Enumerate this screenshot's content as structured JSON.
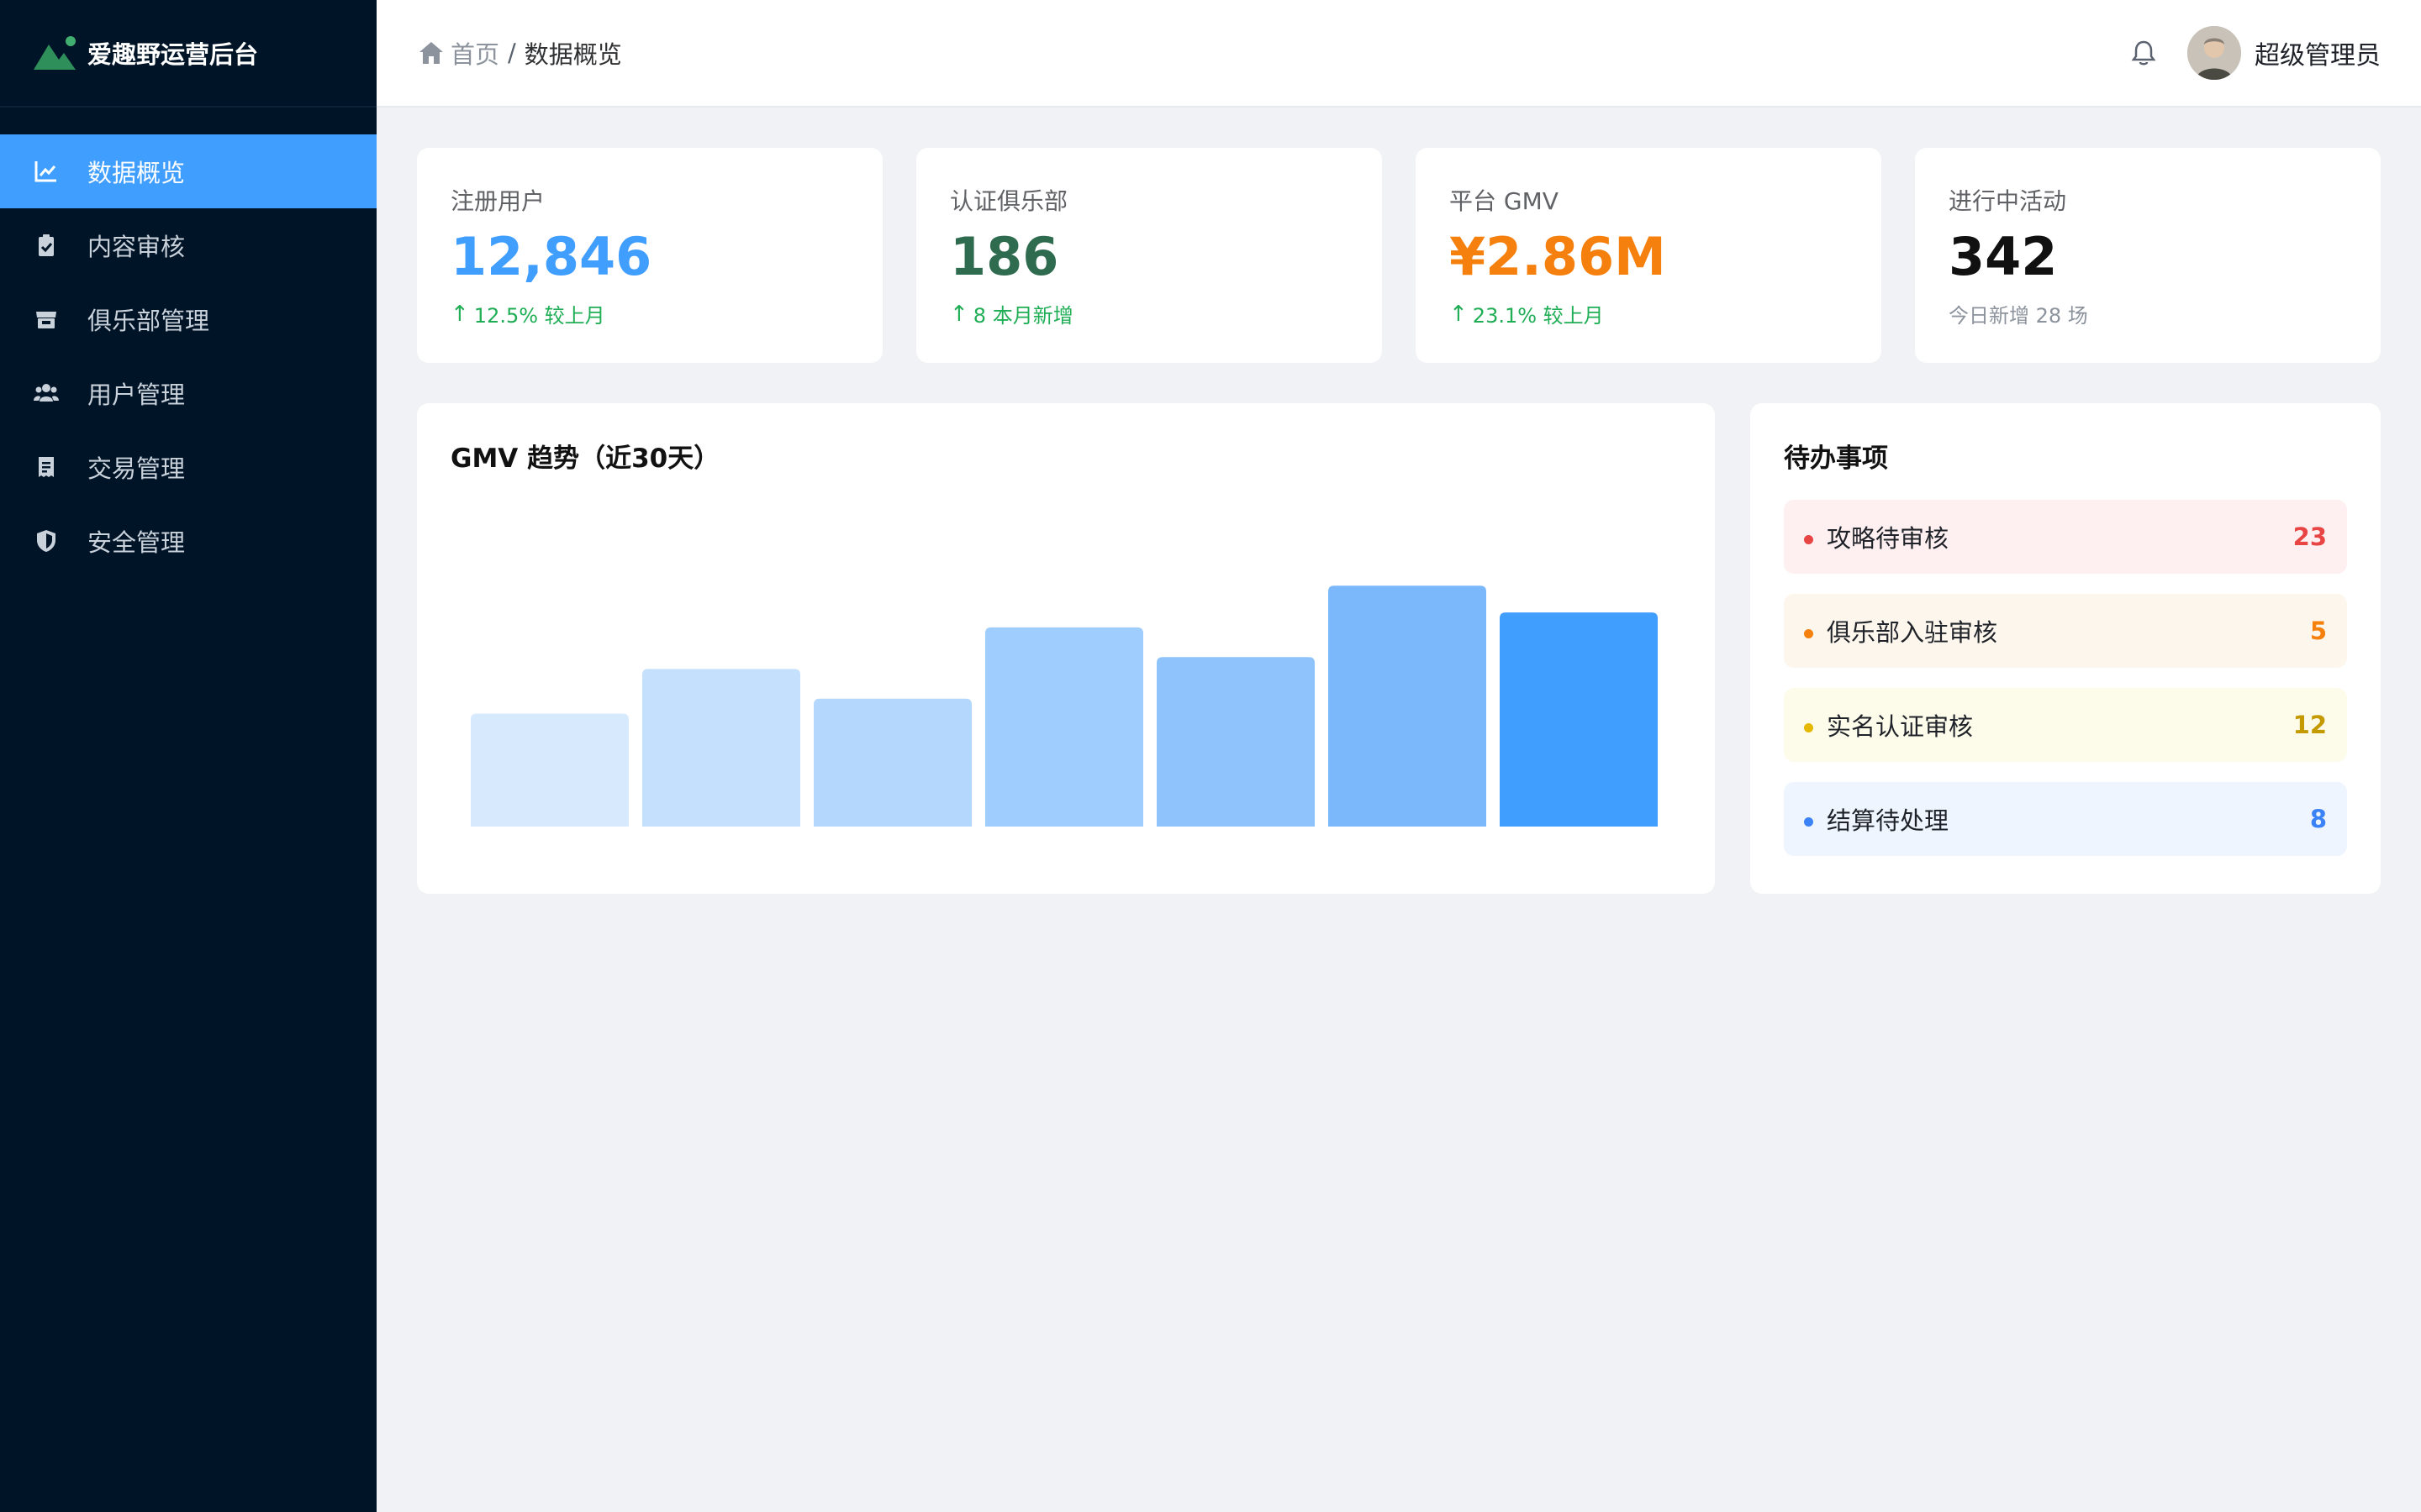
{
  "brand": {
    "title": "爱趣野运营后台",
    "logo_icon": "mountain-logo-icon",
    "accent": "#2f8f5b"
  },
  "sidebar": {
    "items": [
      {
        "label": "数据概览",
        "icon": "chart-line-icon",
        "active": true
      },
      {
        "label": "内容审核",
        "icon": "clipboard-check-icon",
        "active": false
      },
      {
        "label": "俱乐部管理",
        "icon": "store-icon",
        "active": false
      },
      {
        "label": "用户管理",
        "icon": "users-icon",
        "active": false
      },
      {
        "label": "交易管理",
        "icon": "receipt-icon",
        "active": false
      },
      {
        "label": "安全管理",
        "icon": "shield-icon",
        "active": false
      }
    ],
    "active_color": "#409eff"
  },
  "header": {
    "breadcrumb": {
      "home": "首页",
      "separator": "/",
      "current": "数据概览"
    },
    "user_name": "超级管理员"
  },
  "stats": [
    {
      "label": "注册用户",
      "value": "12,846",
      "sub": "12.5% 较上月",
      "trend": "up",
      "value_color": "#409eff"
    },
    {
      "label": "认证俱乐部",
      "value": "186",
      "sub": "8 本月新增",
      "trend": "up",
      "value_color": "#2f6b4f"
    },
    {
      "label": "平台 GMV",
      "value": "¥2.86M",
      "sub": "23.1% 较上月",
      "trend": "up",
      "value_color": "#f5800e"
    },
    {
      "label": "进行中活动",
      "value": "342",
      "sub": "今日新增 28 场",
      "trend": "none",
      "value_color": "#111111"
    }
  ],
  "chart_data": {
    "type": "bar",
    "title": "GMV 趋势（近30天）",
    "values": [
      38,
      53,
      43,
      67,
      57,
      81,
      72
    ],
    "ylim": [
      0,
      100
    ],
    "colors": [
      "#d6e9fd",
      "#c4e0fd",
      "#b3d7fd",
      "#9fcdfd",
      "#8ec3fc",
      "#7ab8fb",
      "#409eff"
    ]
  },
  "todo": {
    "title": "待办事项",
    "items": [
      {
        "label": "攻略待审核",
        "count": "23",
        "dot": "#e84545",
        "bg": "#fef0f0",
        "count_color": "#e84545"
      },
      {
        "label": "俱乐部入驻审核",
        "count": "5",
        "dot": "#f5800e",
        "bg": "#fdf6ec",
        "count_color": "#f5800e"
      },
      {
        "label": "实名认证审核",
        "count": "12",
        "dot": "#e6b800",
        "bg": "#fdfbea",
        "count_color": "#c49a00"
      },
      {
        "label": "结算待处理",
        "count": "8",
        "dot": "#3b82f6",
        "bg": "#eef5fe",
        "count_color": "#3b82f6"
      }
    ]
  }
}
